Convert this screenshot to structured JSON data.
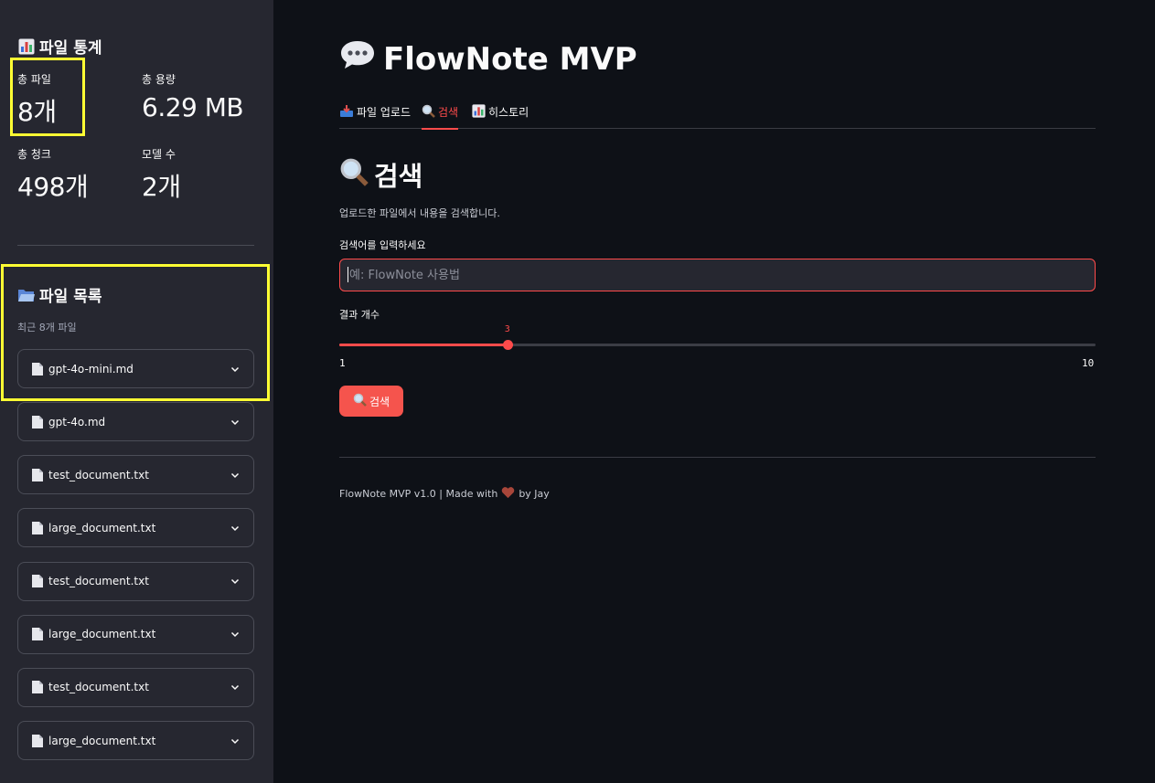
{
  "sidebar": {
    "stats_title": "파일 통계",
    "stats": [
      {
        "label": "총 파일",
        "value": "8개"
      },
      {
        "label": "총 용량",
        "value": "6.29 MB"
      },
      {
        "label": "총 청크",
        "value": "498개"
      },
      {
        "label": "모델 수",
        "value": "2개"
      }
    ],
    "files_title": "파일 목록",
    "files_caption": "최근 8개 파일",
    "files": [
      "gpt-4o-mini.md",
      "gpt-4o.md",
      "test_document.txt",
      "large_document.txt",
      "test_document.txt",
      "large_document.txt",
      "test_document.txt",
      "large_document.txt"
    ]
  },
  "header": {
    "title": "FlowNote MVP"
  },
  "tabs": [
    {
      "label": "파일 업로드",
      "icon": "inbox-tray-icon"
    },
    {
      "label": "검색",
      "icon": "magnifier-icon",
      "active": true
    },
    {
      "label": "히스토리",
      "icon": "bar-chart-icon"
    }
  ],
  "search": {
    "title": "검색",
    "description": "업로드한 파일에서 내용을 검색합니다.",
    "input_label": "검색어를 입력하세요",
    "placeholder": "예: FlowNote 사용법",
    "slider_label": "결과 개수",
    "slider_min": "1",
    "slider_max": "10",
    "slider_value": "3",
    "button_label": "검색"
  },
  "footer": {
    "text_before": "FlowNote MVP v1.0 | Made with",
    "text_after": "by Jay"
  },
  "colors": {
    "accent": "#ff4b4b",
    "highlight": "#ffff33",
    "sidebar_bg": "#262730",
    "main_bg": "#0e1117"
  }
}
